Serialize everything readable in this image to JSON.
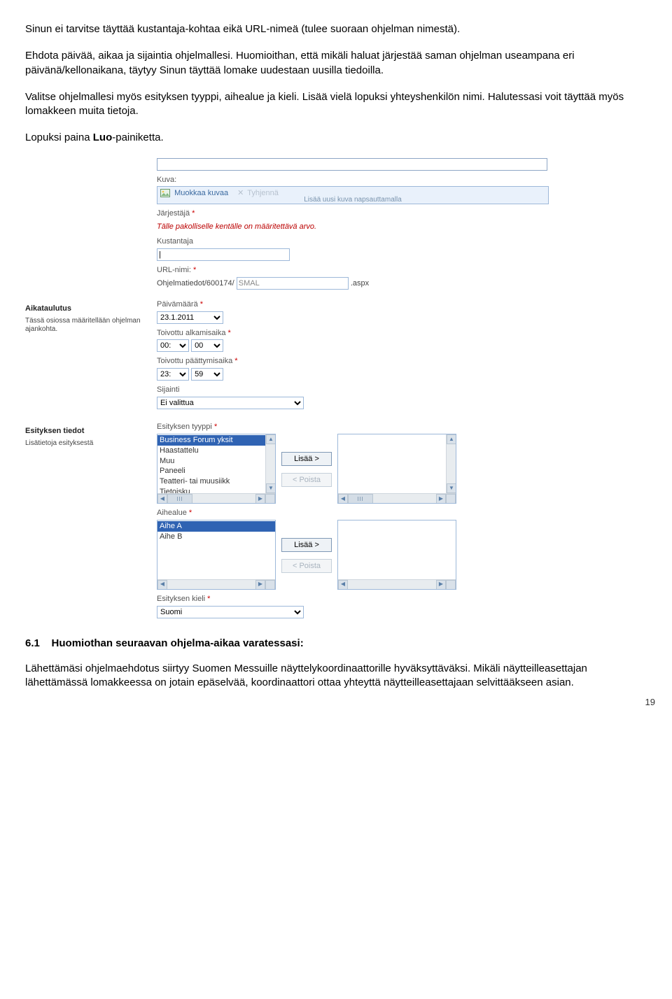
{
  "doc": {
    "p1": "Sinun ei tarvitse täyttää kustantaja-kohtaa eikä URL-nimeä (tulee suoraan ohjelman nimestä).",
    "p2": "Ehdota päivää, aikaa ja sijaintia ohjelmallesi. Huomioithan, että mikäli haluat järjestää saman ohjelman useampana eri päivänä/kellonaikana, täytyy Sinun täyttää lomake uudestaan uusilla tiedoilla.",
    "p3": "Valitse ohjelmallesi myös esityksen tyyppi, aihealue ja kieli. Lisää vielä lopuksi yhteyshenkilön nimi. Halutessasi voit täyttää myös lomakkeen muita tietoja.",
    "p4_pre": "Lopuksi paina ",
    "p4_bold": "Luo",
    "p4_post": "-painiketta.",
    "sec61_pre": "6.1",
    "sec61_title": "Huomiothan seuraavan ohjelma-aikaa varatessasi:",
    "p5": "Lähettämäsi ohjelmaehdotus siirtyy Suomen Messuille näyttelykoordinaattorille hyväksyttäväksi. Mikäli näytteilleasettajan lähettämässä lomakkeessa on jotain epäselvää, koordinaattori ottaa yhteyttä näytteilleasettajaan selvittääkseen asian.",
    "page_number": "19"
  },
  "form": {
    "kuva_label": "Kuva:",
    "edit_image": "Muokkaa kuvaa",
    "clear": "Tyhjennä",
    "image_caption": "Lisää uusi kuva napsauttamalla",
    "jarjestaja_label": "Järjestäjä",
    "required_error": "Tälle pakolliselle kentälle on määritettävä arvo.",
    "kustantaja_label": "Kustantaja",
    "url_label": "URL-nimi:",
    "url_path": "Ohjelmatiedot/600174/",
    "url_value": "SMAL",
    "url_suffix": ".aspx",
    "aikataulutus_heading": "Aikataulutus",
    "aikataulutus_desc": "Tässä osiossa määritellään ohjelman ajankohta.",
    "pvm_label": "Päivämäärä",
    "pvm_value": "23.1.2011",
    "alku_label": "Toivottu alkamisaika",
    "alku_hh": "00:",
    "alku_mm": "00",
    "loppu_label": "Toivottu päättymisaika",
    "loppu_hh": "23:",
    "loppu_mm": "59",
    "sijainti_label": "Sijainti",
    "sijainti_value": "Ei valittua",
    "esitys_heading": "Esityksen tiedot",
    "esitys_desc": "Lisätietoja esityksestä",
    "tyyppi_label": "Esityksen tyyppi",
    "tyyppi_options": [
      "Business Forum yksit",
      "Haastattelu",
      "Muu",
      "Paneeli",
      "Teatteri- tai muusiikk",
      "Tietoisku"
    ],
    "aihealue_label": "Aihealue",
    "aihealue_options": [
      "Aihe A",
      "Aihe B"
    ],
    "lisaa_btn": "Lisää >",
    "poista_btn": "< Poista",
    "kieli_label": "Esityksen kieli",
    "kieli_value": "Suomi"
  }
}
